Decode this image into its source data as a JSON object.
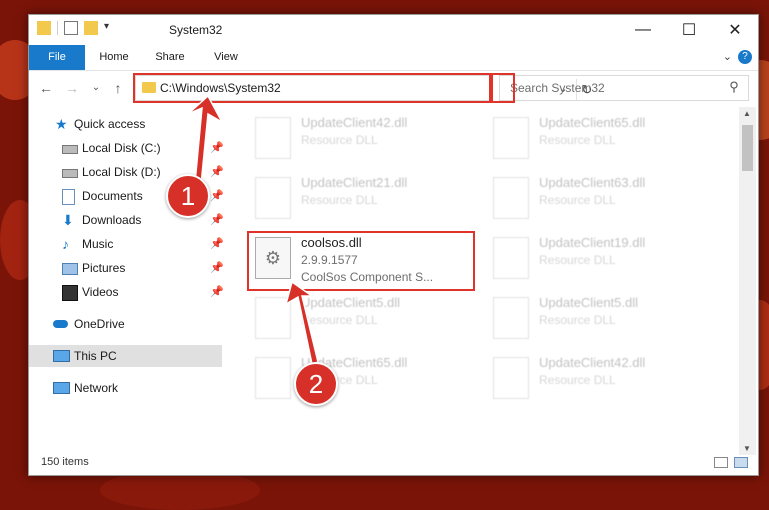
{
  "window": {
    "title": "System32"
  },
  "ribbon": {
    "tabs": [
      "File",
      "Home",
      "Share",
      "View"
    ]
  },
  "address": {
    "path": "C:\\Windows\\System32",
    "search_placeholder": "Search System32"
  },
  "sidebar": {
    "items": [
      {
        "label": "Quick access",
        "icon": "star-icon",
        "pinned": false
      },
      {
        "label": "Local Disk (C:)",
        "icon": "drive-icon",
        "pinned": true
      },
      {
        "label": "Local Disk (D:)",
        "icon": "drive-icon",
        "pinned": true
      },
      {
        "label": "Documents",
        "icon": "documents-icon",
        "pinned": true
      },
      {
        "label": "Downloads",
        "icon": "downloads-icon",
        "pinned": true
      },
      {
        "label": "Music",
        "icon": "music-icon",
        "pinned": true
      },
      {
        "label": "Pictures",
        "icon": "pictures-icon",
        "pinned": true
      },
      {
        "label": "Videos",
        "icon": "videos-icon",
        "pinned": true
      },
      {
        "label": "OneDrive",
        "icon": "cloud-icon",
        "pinned": false
      },
      {
        "label": "This PC",
        "icon": "computer-icon",
        "pinned": false
      },
      {
        "label": "Network",
        "icon": "network-icon",
        "pinned": false
      }
    ]
  },
  "files": [
    {
      "name": "UpdateClient42.dll",
      "type": "Resource DLL",
      "extra": ""
    },
    {
      "name": "UpdateClient65.dll",
      "type": "Resource DLL",
      "extra": ""
    },
    {
      "name": "UpdateClient21.dll",
      "type": "Resource DLL",
      "extra": ""
    },
    {
      "name": "UpdateClient63.dll",
      "type": "Resource DLL",
      "extra": ""
    },
    {
      "name": "coolsos.dll",
      "type": "2.9.9.1577",
      "extra": "CoolSos Component S..."
    },
    {
      "name": "UpdateClient19.dll",
      "type": "Resource DLL",
      "extra": ""
    },
    {
      "name": "UpdateClient5.dll",
      "type": "Resource DLL",
      "extra": ""
    },
    {
      "name": "UpdateClient5.dll",
      "type": "Resource DLL",
      "extra": ""
    },
    {
      "name": "UpdateClient65.dll",
      "type": "Resource DLL",
      "extra": ""
    },
    {
      "name": "UpdateClient42.dll",
      "type": "Resource DLL",
      "extra": ""
    }
  ],
  "status": {
    "count": "150 items"
  },
  "annotations": {
    "step1": "1",
    "step2": "2"
  },
  "colors": {
    "accent": "#1979ca",
    "highlight": "#e0342b",
    "marker": "#d63028"
  }
}
